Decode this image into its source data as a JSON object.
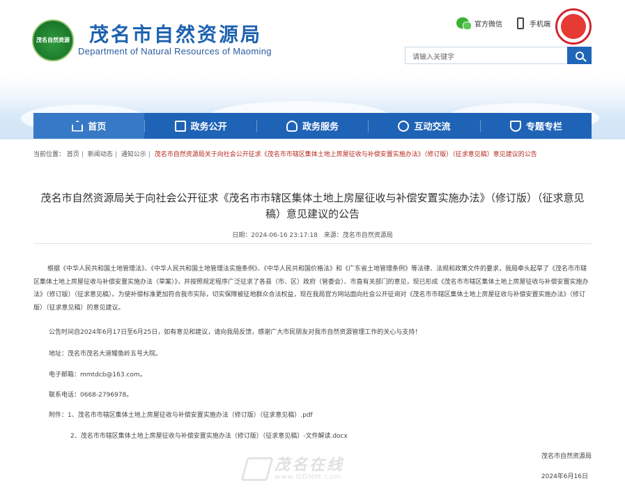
{
  "header": {
    "logo_text": "茂名自然资源",
    "title_cn": "茂名市自然资源局",
    "title_en": "Department of Natural Resources of Maoming",
    "wechat_label": "官方微信",
    "mobile_label": "手机端",
    "search_placeholder": "请输入关键字"
  },
  "nav": {
    "items": [
      {
        "label": "首页",
        "icon": "home-icon"
      },
      {
        "label": "政务公开",
        "icon": "document-icon"
      },
      {
        "label": "政务服务",
        "icon": "service-icon"
      },
      {
        "label": "互动交流",
        "icon": "chat-icon"
      },
      {
        "label": "专题专栏",
        "icon": "trophy-icon"
      }
    ]
  },
  "breadcrumb": {
    "prefix": "当前位置：",
    "items": [
      "首页",
      "新闻动态",
      "通知公示"
    ],
    "current": "茂名市自然资源局关于向社会公开征求《茂名市市辖区集体土地上房屋征收与补偿安置实施办法》（修订版）（征求意见稿）意见建议的公告"
  },
  "article": {
    "title": "茂名市自然资源局关于向社会公开征求《茂名市市辖区集体土地上房屋征收与补偿安置实施办法》（修订版）（征求意见稿）意见建议的公告",
    "date": "日期：2024-06-16 23:17:18",
    "source": "来源：茂名市自然资源局",
    "paragraph1": "根据《中华人民共和国土地管理法》、《中华人民共和国土地管理法实施条例》、《中华人民共和国价格法》和《广东省土地管理条例》等法律、法规和政策文件的要求，我局牵头起草了《茂名市市辖区集体土地上房屋征收与补偿安置实施办法（草案）》，并按照规定程序广泛征求了各县（市、区）政府（管委会）、市直有关部门的意见，现已形成《茂名市市辖区集体土地上房屋征收与补偿安置实施办法》（修订版）（征求意见稿）。为使补偿标准更加符合我市实际，切实保障被征地群众合法权益，现在我局官方网站面向社会公开征询对《茂名市市辖区集体土地上房屋征收与补偿安置实施办法》（修订版）（征求意见稿）的意见建议。",
    "notice_period": "公告时间自2024年6月17日至6月25日，如有意见和建议，请向我局反馈，感谢广大市民朋友对我市自然资源管理工作的关心与支持！",
    "address": "地址：茂名市茂名大道鳗鱼岭五号大院。",
    "email": "电子邮箱：mmtdcb@163.com。",
    "phone": "联系电话：0668-2796978。",
    "attachment_prefix": "附件：",
    "attachment1": "1、茂名市市辖区集体土地上房屋征收与补偿安置实施办法（修订版）（征求意见稿）.pdf",
    "attachment2": "2、茂名市市辖区集体土地上房屋征收与补偿安置实施办法（修订版）（征求意见稿）-文件解读.docx",
    "signature": "茂名市自然资源局",
    "sign_date": "2024年6月16日"
  },
  "watermark": {
    "main": "茂名在线",
    "sub": "www.GDMM.com"
  }
}
